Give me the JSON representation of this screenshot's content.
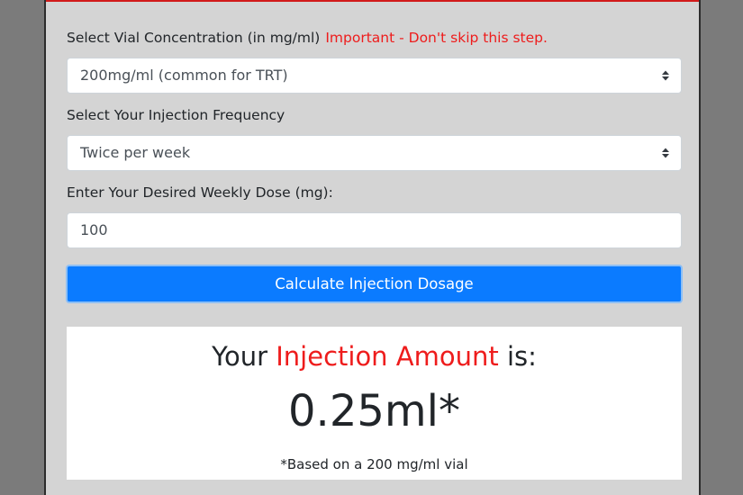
{
  "form": {
    "concentration_label": "Select Vial Concentration (in mg/ml)",
    "concentration_warning": "Important - Don't skip this step.",
    "concentration_selected": "200mg/ml (common for TRT)",
    "frequency_label": "Select Your Injection Frequency",
    "frequency_selected": "Twice per week",
    "dose_label": "Enter Your Desired Weekly Dose (mg):",
    "dose_value": "100",
    "calculate_label": "Calculate Injection Dosage"
  },
  "result": {
    "heading_prefix": "Your ",
    "heading_accent": "Injection Amount",
    "heading_suffix": " is:",
    "value": "0.25ml*",
    "note": "*Based on a 200 mg/ml vial"
  },
  "colors": {
    "panel_background": "#d4d4d4",
    "outer_background": "#7b7b7b",
    "accent_red": "#ee1c1c",
    "button_blue": "#0b7bff"
  },
  "icons": {
    "select_caret": "chevron-up-down-icon"
  }
}
